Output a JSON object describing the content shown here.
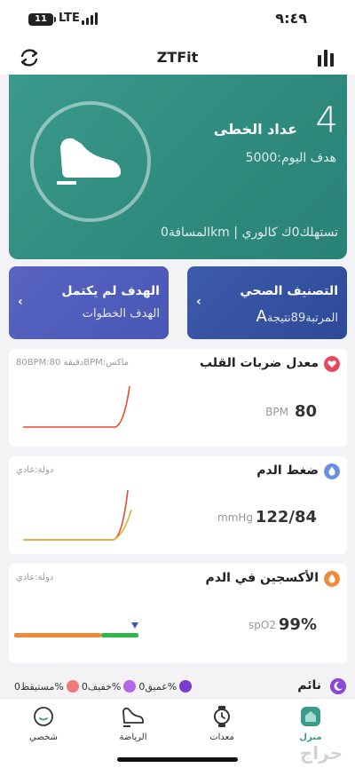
{
  "status_bar": {
    "battery": "11",
    "network": "LTE",
    "time": "٩:٤٩"
  },
  "app_bar": {
    "title": "ZTFit"
  },
  "steps": {
    "count": "4",
    "label": "عداد الخطى",
    "goal_text": "هدف اليوم:5000",
    "distance_text": "المسافة0km | تستهلك0ك كالوري"
  },
  "health_score": {
    "title": "التصنيف الصحي",
    "rank_text": "المرتبة89نتيجة",
    "grade": "A",
    "chevron": "‹"
  },
  "goal_card": {
    "title": "الهدف لم يكتمل",
    "subtitle": "الهدف الخطوات",
    "chevron": "‹"
  },
  "heart_rate": {
    "title": "معدل ضربات القلب",
    "meta": "80BPM:دقيقة   80BPM:ماكس",
    "value": "80",
    "unit": "BPM",
    "icon": "heart-icon",
    "color": "#e8455e"
  },
  "blood_pressure": {
    "title": "ضغط الدم",
    "meta": "دولة:عادي",
    "value": "122/84",
    "unit": "mmHg",
    "icon": "drop-icon",
    "color": "#6a8fe0"
  },
  "oxygen": {
    "title": "الأكسجين في الدم",
    "meta": "دولة:عادي",
    "value": "99%",
    "unit": "spO2",
    "icon": "oxygen-icon",
    "color": "#f08a3a"
  },
  "sleep": {
    "title": "نائم",
    "legend": [
      {
        "label": "مستيقظ0%",
        "color": "#f07a7a"
      },
      {
        "label": "خفيف0%",
        "color": "#b466e6"
      },
      {
        "label": "عميق0%",
        "color": "#7a3ccf"
      }
    ]
  },
  "tabs": [
    {
      "label": "منزل",
      "icon": "home-icon",
      "active": true
    },
    {
      "label": "معدات",
      "icon": "watch-icon",
      "active": false
    },
    {
      "label": "الرياضة",
      "icon": "shoe-icon",
      "active": false
    },
    {
      "label": "شخصي",
      "icon": "person-icon",
      "active": false
    }
  ],
  "watermark": "حراج"
}
